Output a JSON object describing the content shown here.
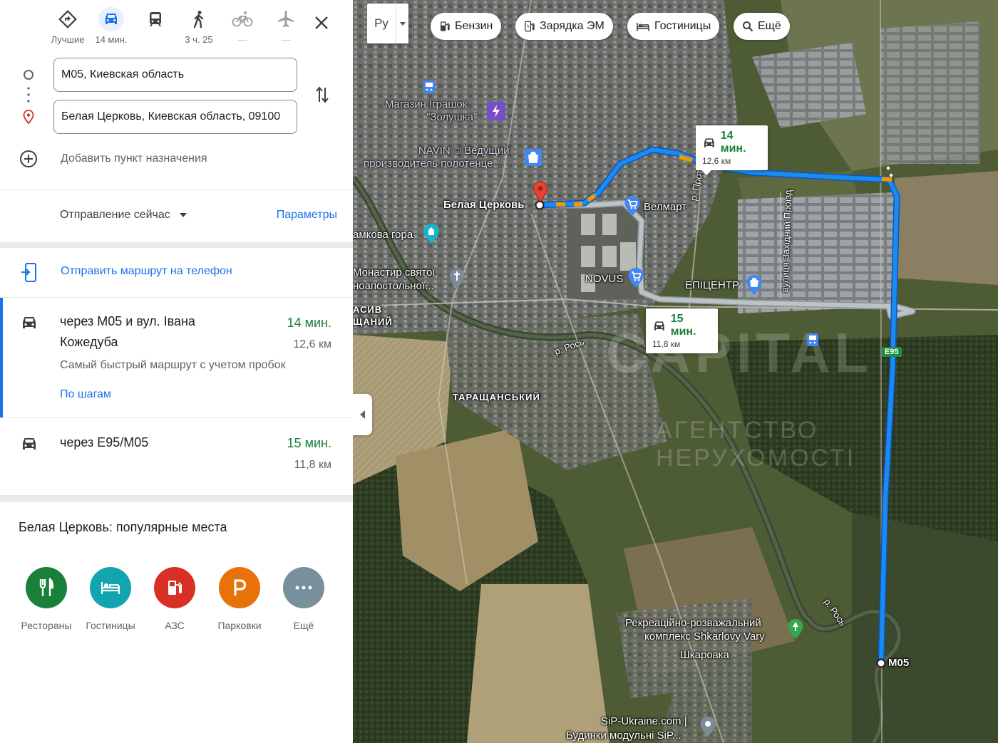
{
  "modes": [
    {
      "key": "best",
      "label": "Лучшие",
      "icon": "best-route-icon"
    },
    {
      "key": "car",
      "label": "14 мин.",
      "icon": "car-icon"
    },
    {
      "key": "transit",
      "label": "",
      "icon": "transit-icon"
    },
    {
      "key": "walk",
      "label": "3 ч. 25",
      "icon": "walk-icon"
    },
    {
      "key": "bike",
      "label": "—",
      "icon": "bike-icon"
    },
    {
      "key": "flight",
      "label": "—",
      "icon": "flight-icon"
    }
  ],
  "waypoints": {
    "origin": "М05, Киевская область",
    "destination": "Белая Церковь, Киевская область, 09100",
    "add_destination": "Добавить пункт назначения"
  },
  "departure": {
    "label": "Отправление сейчас",
    "options_link": "Параметры"
  },
  "send_to_phone": "Отправить маршрут на телефон",
  "routes": [
    {
      "via": "через М05 и вул. Івана Кожедуба",
      "time": "14 мин.",
      "distance": "12,6 км",
      "description": "Самый быстрый маршрут с учетом пробок",
      "steps_link": "По шагам"
    },
    {
      "via": "через E95/M05",
      "time": "15 мин.",
      "distance": "11,8 км"
    }
  ],
  "popular": {
    "title": "Белая Церковь: популярные места",
    "categories": [
      {
        "label": "Рестораны",
        "color": "#188038",
        "icon": "restaurant-icon"
      },
      {
        "label": "Гостиницы",
        "color": "#12a4af",
        "icon": "hotel-icon"
      },
      {
        "label": "АЗС",
        "color": "#d93025",
        "icon": "gas-station-icon"
      },
      {
        "label": "Парковки",
        "color": "#e8710a",
        "icon": "parking-icon"
      },
      {
        "label": "Ещё",
        "color": "#78909c",
        "icon": "more-icon"
      }
    ]
  },
  "map": {
    "layer_button": "Ру",
    "chips": [
      "Бензин",
      "Зарядка ЭМ",
      "Гостиницы",
      "Ещё"
    ],
    "callout_fast": {
      "time": "14 мин.",
      "distance": "12,6 км"
    },
    "callout_alt": {
      "time": "15 мин.",
      "distance": "11,8 км"
    },
    "labels": {
      "city": "Белая Церковь",
      "toy_store_1": "Магазин Іграшок",
      "toy_store_2": "\"Золушка\"",
      "navin_1": "NAVIN © Ведущий",
      "navin_2": "производитель полотенце...",
      "velmart": "Велмарт",
      "zamkova": "амкова гора",
      "monastery_1": "Монастир святої",
      "monastery_2": "ноапостольної...",
      "novus": "NOVUS",
      "epicentr": "ЕПІЦЕНТР",
      "masyv_1": "АСИВ",
      "masyv_2": "ЩАНИЙ",
      "tarashchansky": "ТАРАЩАНСЬКИЙ",
      "protoka": "р. Протока",
      "zakhidny": "вулиця Західний Проїзд",
      "ros_1": "р. Рось",
      "ros_2": "р. Рось",
      "e95": "E95",
      "m05": "M05",
      "recreation_1": "Рекреаційно-розважальний",
      "recreation_2": "комплекс Shkarlovy Vary",
      "shkarovka": "Шкаровка",
      "sip_1": "SiP-Ukraine.com |",
      "sip_2": "Будинки модульні SiP..."
    },
    "watermark": "CAPITAL",
    "watermark_sub": "АГЕНТСТВО НЕРУХОМОСТІ",
    "colors": {
      "route_main": "#1a73e8",
      "route_alt": "#bcc3c7",
      "traffic": "#f29900"
    }
  }
}
